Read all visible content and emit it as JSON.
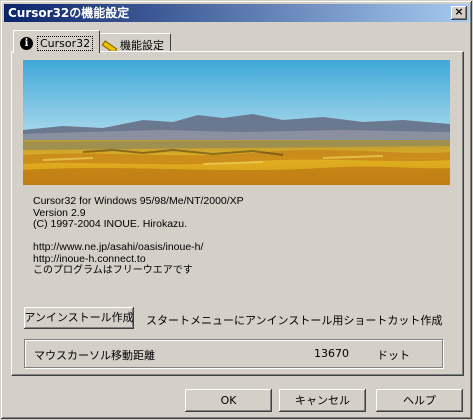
{
  "window": {
    "title": "Cursor32の機能設定",
    "close_glyph": "×"
  },
  "tabs": [
    {
      "label": "Cursor32",
      "icon": "info-icon",
      "active": true
    },
    {
      "label": "機能設定",
      "icon": "pencil-icon",
      "active": false
    }
  ],
  "about": {
    "line1": "Cursor32 for Windows 95/98/Me/NT/2000/XP",
    "line2": "Version 2.9",
    "line3": "(C) 1997-2004 INOUE. Hirokazu.",
    "url1": "http://www.ne.jp/asahi/oasis/inoue-h/",
    "url2": "http://inoue-h.connect.to",
    "freeware": "このプログラムはフリーウエアです"
  },
  "uninstall": {
    "button_label": "アンインストール作成",
    "description": "スタートメニューにアンインストール用ショートカット作成"
  },
  "distance": {
    "label": "マウスカーソル移動距離",
    "value": "13670",
    "unit": "ドット"
  },
  "buttons": {
    "ok": "OK",
    "cancel": "キャンセル",
    "help": "ヘルプ"
  },
  "colors": {
    "title_start": "#0a246a",
    "title_end": "#a6caf0",
    "face": "#d4d0c8"
  }
}
